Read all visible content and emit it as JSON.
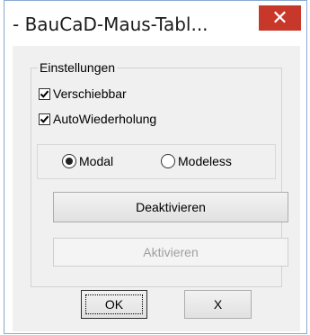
{
  "window": {
    "title": "- BauCaD-Maus-Tabl...",
    "close_label": "✕"
  },
  "group": {
    "title": "Einstellungen",
    "checkboxes": [
      {
        "label": "Verschiebbar",
        "checked": true
      },
      {
        "label": "AutoWiederholung",
        "checked": true
      }
    ],
    "radios": [
      {
        "label": "Modal",
        "selected": true
      },
      {
        "label": "Modeless",
        "selected": false
      }
    ],
    "buttons": {
      "deactivate": "Deaktivieren",
      "activate": "Aktivieren"
    }
  },
  "footer": {
    "ok": "OK",
    "cancel": "X"
  }
}
